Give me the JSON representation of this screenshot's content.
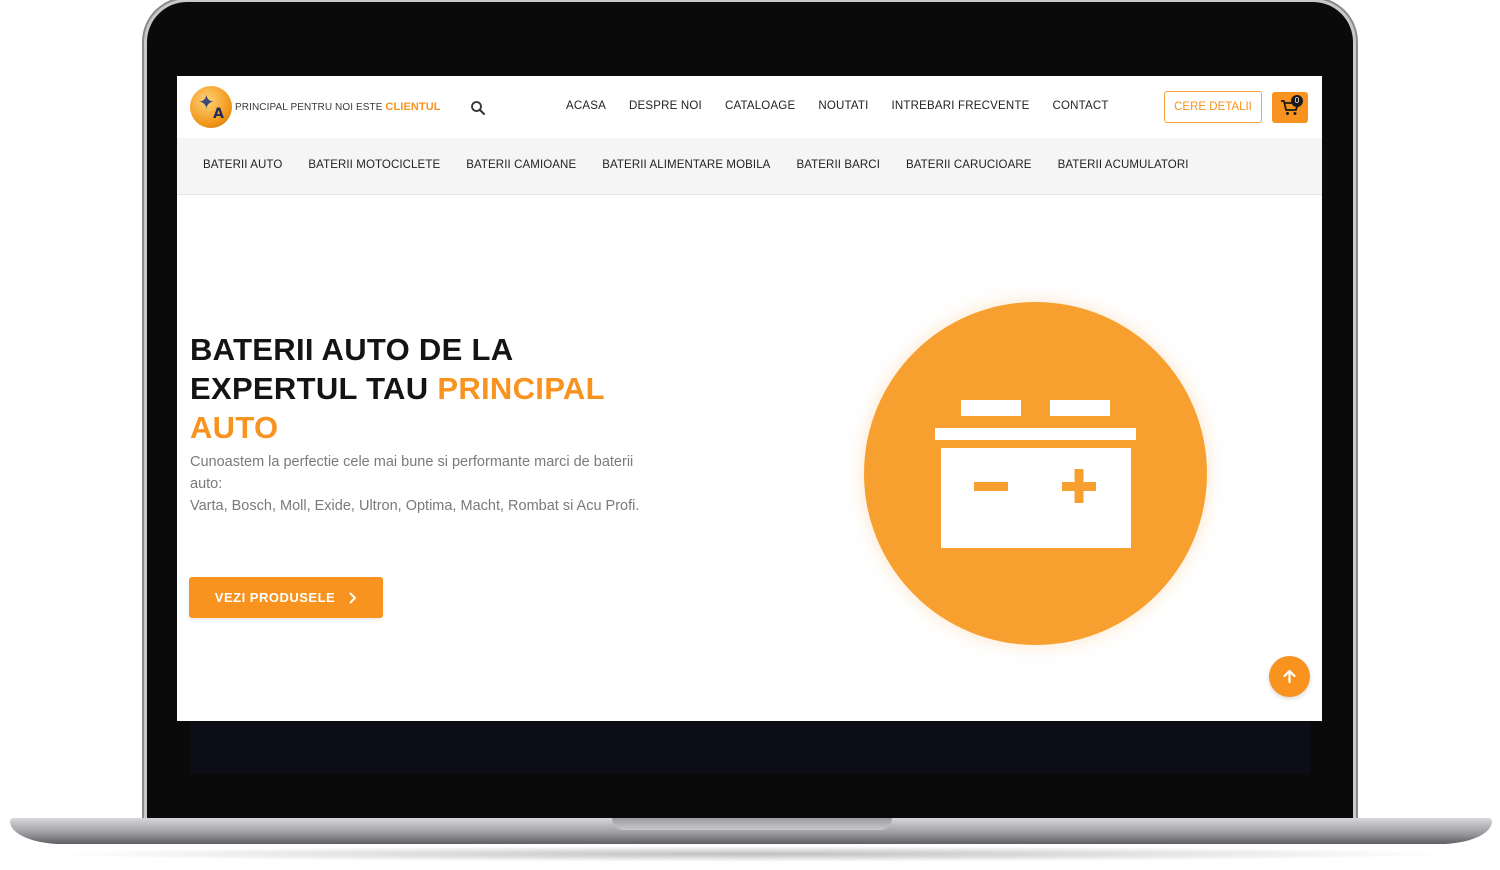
{
  "header": {
    "tagline_prefix": "PRINCIPAL PENTRU NOI ESTE",
    "tagline_highlight": "CLIENTUL",
    "logo_letter": "A",
    "nav": [
      "ACASA",
      "DESPRE NOI",
      "CATALOAGE",
      "NOUTATI",
      "INTREBARI FRECVENTE",
      "CONTACT"
    ],
    "cta_label": "CERE DETALII",
    "cart_count": "0"
  },
  "subnav": {
    "items": [
      "BATERII AUTO",
      "BATERII MOTOCICLETE",
      "BATERII CAMIOANE",
      "BATERII ALIMENTARE MOBILA",
      "BATERII BARCI",
      "BATERII CARUCIOARE",
      "BATERII ACUMULATORI"
    ]
  },
  "hero": {
    "title_line1": "BATERII AUTO DE LA",
    "title_line2": "EXPERTUL TAU",
    "title_accent": "PRINCIPAL AUTO",
    "desc_line1": "Cunoastem la perfectie cele mai bune si performante marci de baterii auto:",
    "desc_line2": "Varta, Bosch, Moll, Exide, Ultron, Optima, Macht, Rombat si Acu Profi.",
    "button_label": "VEZI PRODUSELE"
  },
  "icons": {
    "search": "search-icon",
    "cart": "cart-icon",
    "chevron": "chevron-right-icon",
    "battery": "battery-icon",
    "arrow_up": "arrow-up-icon"
  },
  "colors": {
    "accent": "#f7931e",
    "circle": "#f7a030",
    "text": "#141414",
    "muted": "#7a7a7a",
    "subnav_bg": "#f5f5f5"
  }
}
